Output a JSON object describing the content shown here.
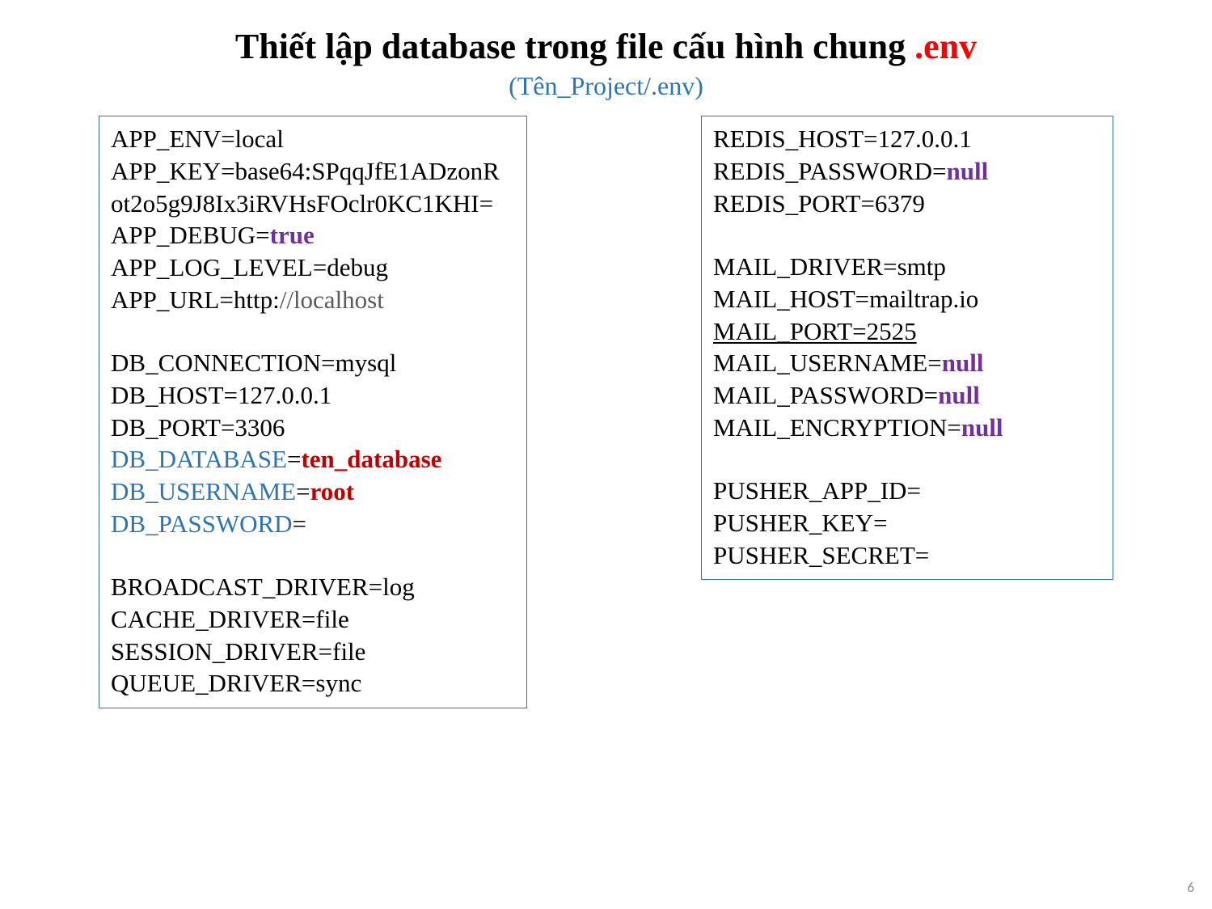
{
  "title": {
    "main": "Thiết lập database trong file cấu hình chung ",
    "env": ".env",
    "sub": "(Tên_Project/.env)"
  },
  "left": {
    "app_env": "APP_ENV=local",
    "app_key_1": "APP_KEY=base64:SPqqJfE1ADzonR",
    "app_key_2": "ot2o5g9J8Ix3iRVHsFOclr0KC1KHI=",
    "app_debug_pre": "APP_DEBUG=",
    "app_debug_val": "true",
    "app_log": "APP_LOG_LEVEL=debug",
    "app_url_pre": "APP_URL=http:",
    "app_url_sep": "//",
    "app_url_host": "localhost",
    "db_conn": "DB_CONNECTION=mysql",
    "db_host": "DB_HOST=127.0.0.1",
    "db_port": "DB_PORT=3306",
    "db_database_key": "DB_DATABASE",
    "db_database_eq": "=",
    "db_database_val": "ten_database",
    "db_username_key": "DB_USERNAME",
    "db_username_eq": "=",
    "db_username_val": "root",
    "db_password_key": "DB_PASSWORD",
    "db_password_eq": "=",
    "broadcast": "BROADCAST_DRIVER=log",
    "cache": "CACHE_DRIVER=file",
    "session": "SESSION_DRIVER=file",
    "queue": "QUEUE_DRIVER=sync"
  },
  "right": {
    "redis_host": "REDIS_HOST=127.0.0.1",
    "redis_pw_pre": "REDIS_PASSWORD=",
    "redis_pw_val": "null",
    "redis_port": "REDIS_PORT=6379",
    "mail_driver": "MAIL_DRIVER=smtp",
    "mail_host": "MAIL_HOST=mailtrap.io",
    "mail_port": "MAIL_PORT=2525",
    "mail_user_pre": "MAIL_USERNAME=",
    "mail_user_val": "null",
    "mail_pw_pre": "MAIL_PASSWORD=",
    "mail_pw_val": "null",
    "mail_enc_pre": "MAIL_ENCRYPTION=",
    "mail_enc_val": "null",
    "pusher_app": "PUSHER_APP_ID=",
    "pusher_key": "PUSHER_KEY=",
    "pusher_secret": "PUSHER_SECRET="
  },
  "page": "6"
}
